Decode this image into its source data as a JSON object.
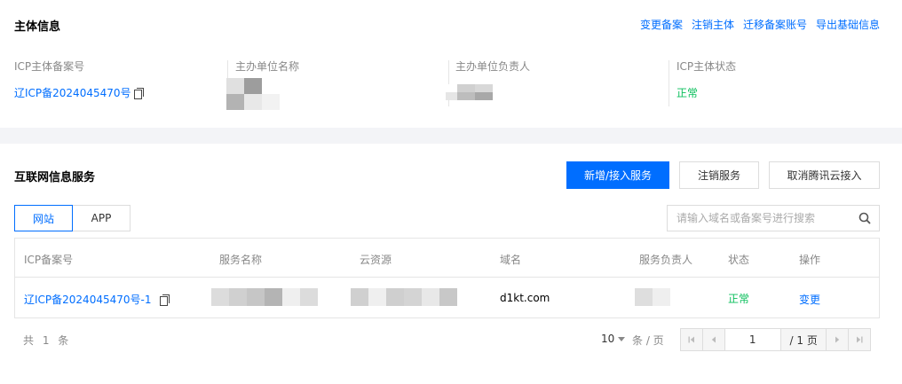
{
  "subject": {
    "title": "主体信息",
    "actions": [
      "变更备案",
      "注销主体",
      "迁移备案账号",
      "导出基础信息"
    ],
    "fields": [
      {
        "label": "ICP主体备案号",
        "value": "辽ICP备2024045470号"
      },
      {
        "label": "主办单位名称",
        "value": ""
      },
      {
        "label": "主办单位负责人",
        "value": ""
      },
      {
        "label": "ICP主体状态",
        "value": "正常"
      }
    ]
  },
  "service": {
    "title": "互联网信息服务",
    "buttons": {
      "add": "新增/接入服务",
      "cancel": "注销服务",
      "cancel_access": "取消腾讯云接入"
    },
    "tabs": [
      "网站",
      "APP"
    ],
    "search_placeholder": "请输入域名或备案号进行搜索",
    "table": {
      "headers": [
        "ICP备案号",
        "服务名称",
        "云资源",
        "域名",
        "服务负责人",
        "状态",
        "操作"
      ],
      "rows": [
        {
          "icp": "辽ICP备2024045470号-1",
          "name": "",
          "resource": "",
          "domain": "d1kt.com",
          "owner": "",
          "status": "正常",
          "action": "变更"
        }
      ]
    },
    "pagination": {
      "total": "共 1 条",
      "page_size": "10",
      "per_page_label": "条 / 页",
      "current_page": "1",
      "total_pages": "/ 1 页"
    }
  },
  "colors": {
    "accent": "#006eff",
    "success": "#0abf5b"
  }
}
